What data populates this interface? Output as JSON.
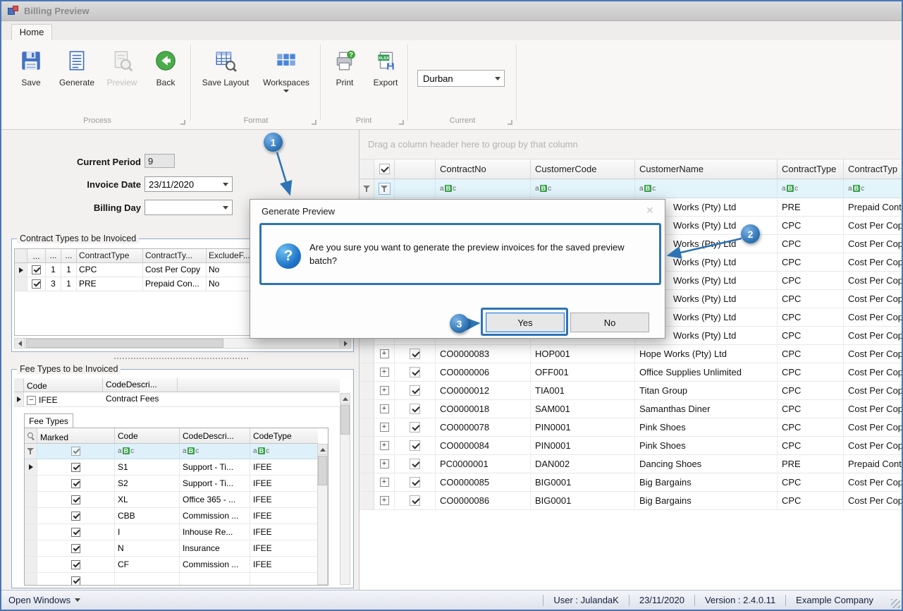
{
  "window": {
    "title": "Billing Preview"
  },
  "ribbon": {
    "tab": "Home",
    "buttons": {
      "save": "Save",
      "generate": "Generate",
      "preview": "Preview",
      "back": "Back",
      "save_layout": "Save Layout",
      "workspaces": "Workspaces",
      "print": "Print",
      "export": "Export"
    },
    "captions": {
      "process": "Process",
      "format": "Format",
      "print": "Print",
      "current": "Current"
    },
    "current_combo": "Durban"
  },
  "form": {
    "current_period_label": "Current Period",
    "current_period_value": "9",
    "invoice_date_label": "Invoice Date",
    "invoice_date_value": "23/11/2020",
    "billing_day_label": "Billing Day",
    "billing_day_value": ""
  },
  "contract_types": {
    "caption": "Contract Types to be Invoiced",
    "columns": [
      "...",
      "...",
      "...",
      "ContractType",
      "ContractTy...",
      "ExcludeF..."
    ],
    "rows": [
      {
        "selected": true,
        "checked": true,
        "n1": "1",
        "n2": "1",
        "type": "CPC",
        "desc": "Cost Per Copy",
        "exclude": "No"
      },
      {
        "selected": false,
        "checked": true,
        "n1": "3",
        "n2": "1",
        "type": "PRE",
        "desc": "Prepaid Con...",
        "exclude": "No"
      }
    ]
  },
  "fee_types": {
    "caption": "Fee Types to be Invoiced",
    "columns": [
      "Code",
      "CodeDescri..."
    ],
    "master": {
      "code": "IFEE",
      "desc": "Contract Fees"
    },
    "detail_tab": "Fee Types",
    "detail_columns": [
      "Marked",
      "Code",
      "CodeDescri...",
      "CodeType"
    ],
    "detail_rows": [
      {
        "current": true,
        "marked": true,
        "code": "S1",
        "desc": "Support - Ti...",
        "type": "IFEE"
      },
      {
        "current": false,
        "marked": true,
        "code": "S2",
        "desc": "Support - Ti...",
        "type": "IFEE"
      },
      {
        "current": false,
        "marked": true,
        "code": "XL",
        "desc": "Office 365 - ...",
        "type": "IFEE"
      },
      {
        "current": false,
        "marked": true,
        "code": "CBB",
        "desc": "Commission ...",
        "type": "IFEE"
      },
      {
        "current": false,
        "marked": true,
        "code": "I",
        "desc": "Inhouse Re...",
        "type": "IFEE"
      },
      {
        "current": false,
        "marked": true,
        "code": "N",
        "desc": "Insurance",
        "type": "IFEE"
      },
      {
        "current": false,
        "marked": true,
        "code": "CF",
        "desc": "Commission ...",
        "type": "IFEE"
      },
      {
        "current": false,
        "marked": true,
        "code": "",
        "desc": "",
        "type": ""
      }
    ]
  },
  "grid": {
    "group_panel": "Drag a column header here to group by that column",
    "columns": [
      "ContractNo",
      "CustomerCode",
      "CustomerName",
      "ContractType",
      "ContractTyp"
    ],
    "covered_rows": [
      {
        "name_fragment": "Works (Pty) Ltd",
        "type": "PRE",
        "type_desc": "Prepaid Cont"
      },
      {
        "name_fragment": "Works (Pty) Ltd",
        "type": "CPC",
        "type_desc": "Cost Per Cop"
      },
      {
        "name_fragment": "Works (Pty) Ltd",
        "type": "CPC",
        "type_desc": "Cost Per Cop"
      },
      {
        "name_fragment": "Works (Pty) Ltd",
        "type": "CPC",
        "type_desc": "Cost Per Cop"
      },
      {
        "name_fragment": "Works (Pty) Ltd",
        "type": "CPC",
        "type_desc": "Cost Per Cop"
      },
      {
        "name_fragment": "Works (Pty) Ltd",
        "type": "CPC",
        "type_desc": "Cost Per Cop"
      },
      {
        "name_fragment": "Works (Pty) Ltd",
        "type": "CPC",
        "type_desc": "Cost Per Cop"
      },
      {
        "name_fragment": "Works (Pty) Ltd",
        "type": "CPC",
        "type_desc": "Cost Per Cop"
      }
    ],
    "rows": [
      {
        "no": "CO0000083",
        "code": "HOP001",
        "name": "Hope Works (Pty) Ltd",
        "type": "CPC",
        "type_desc": "Cost Per Cop"
      },
      {
        "no": "CO0000006",
        "code": "OFF001",
        "name": "Office Supplies Unlimited",
        "type": "CPC",
        "type_desc": "Cost Per Cop"
      },
      {
        "no": "CO0000012",
        "code": "TIA001",
        "name": "Titan Group",
        "type": "CPC",
        "type_desc": "Cost Per Cop"
      },
      {
        "no": "CO0000018",
        "code": "SAM001",
        "name": "Samanthas Diner",
        "type": "CPC",
        "type_desc": "Cost Per Cop"
      },
      {
        "no": "CO0000078",
        "code": "PIN0001",
        "name": "Pink Shoes",
        "type": "CPC",
        "type_desc": "Cost Per Cop"
      },
      {
        "no": "CO0000084",
        "code": "PIN0001",
        "name": "Pink Shoes",
        "type": "CPC",
        "type_desc": "Cost Per Cop"
      },
      {
        "no": "PC0000001",
        "code": "DAN002",
        "name": "Dancing Shoes",
        "type": "PRE",
        "type_desc": "Prepaid Cont"
      },
      {
        "no": "CO0000085",
        "code": "BIG0001",
        "name": "Big Bargains",
        "type": "CPC",
        "type_desc": "Cost Per Cop"
      },
      {
        "no": "CO0000086",
        "code": "BIG0001",
        "name": "Big Bargains",
        "type": "CPC",
        "type_desc": "Cost Per Cop"
      }
    ]
  },
  "dialog": {
    "title": "Generate Preview",
    "message": "Are you sure you want to generate the preview invoices for the saved preview batch?",
    "yes_label": "Yes",
    "no_label": "No"
  },
  "annotations": {
    "step1": "1",
    "step2": "2",
    "step3": "3"
  },
  "status_bar": {
    "open_windows": "Open Windows",
    "items": [
      "User : JulandaK",
      "23/11/2020",
      "Version : 2.4.0.11",
      "Example Company"
    ]
  },
  "icons": {
    "abc": "aBc"
  },
  "colors": {
    "annotation": "#2e74b5",
    "selection": "#3a6fc8",
    "filter_row": "#e3f4fb",
    "window_border": "#4a76b8"
  }
}
